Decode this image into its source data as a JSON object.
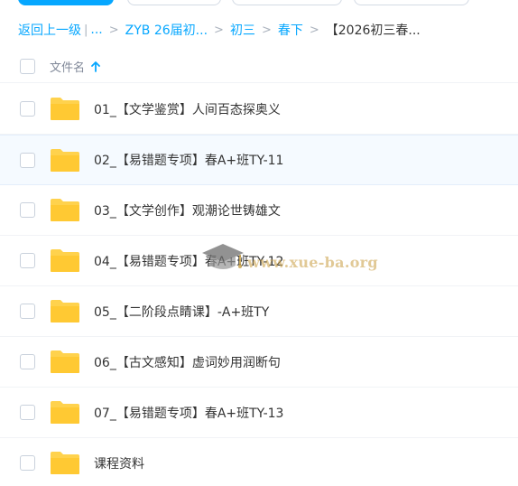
{
  "breadcrumb": {
    "back": "返回上一级",
    "ellipsis": "...",
    "items": [
      "ZYB 26届初...",
      "初三",
      "春下"
    ],
    "current": "【2026初三春..."
  },
  "header": {
    "column_name": "文件名"
  },
  "files": [
    {
      "name": "01_【文学鉴赏】人间百态探奥义",
      "icon": "folder-icon"
    },
    {
      "name": "02_【易错题专项】春A+班TY-11",
      "icon": "folder-icon"
    },
    {
      "name": "03_【文学创作】观潮论世铸雄文",
      "icon": "folder-icon"
    },
    {
      "name": "04_【易错题专项】春A+班TY-12",
      "icon": "folder-icon"
    },
    {
      "name": "05_【二阶段点睛课】-A+班TY",
      "icon": "folder-icon"
    },
    {
      "name": "06_【古文感知】虚词妙用润断句",
      "icon": "folder-icon"
    },
    {
      "name": "07_【易错题专项】春A+班TY-13",
      "icon": "folder-icon"
    },
    {
      "name": "课程资料",
      "icon": "folder-icon"
    }
  ],
  "watermark": {
    "text": "www.xue-ba.org",
    "icon": "graduation-cap-icon"
  },
  "colors": {
    "accent": "#06a7ff",
    "folder": "#ffd24d",
    "hover_row": "#f5faff"
  }
}
